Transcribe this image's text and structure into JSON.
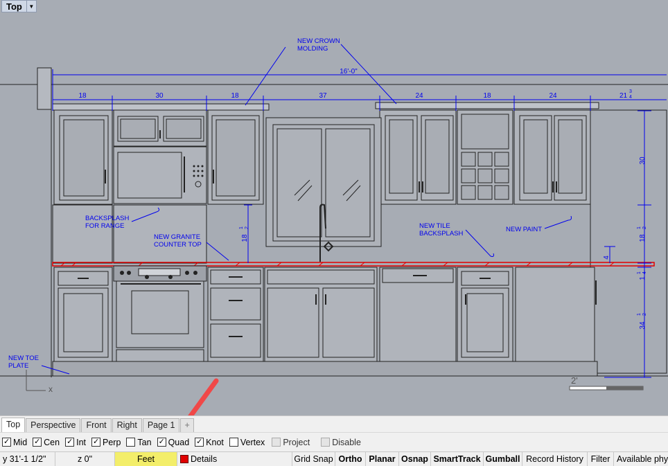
{
  "viewport": {
    "title": "Top",
    "dims": {
      "overall": "16'-0\"",
      "uppers": [
        "18",
        "30",
        "18",
        "37",
        "24",
        "18",
        "24"
      ],
      "right_top": "21",
      "right_top_frac_num": "3",
      "right_top_frac_den": "4",
      "right_upper_h": "30",
      "right_backsplash_whole": "18",
      "right_backsplash_num": "1",
      "right_backsplash_den": "2",
      "center_backsplash_whole": "18",
      "center_backsplash_num": "1",
      "center_backsplash_den": "2",
      "right_4": "4",
      "right_counter_whole": "1",
      "right_counter_num": "1",
      "right_counter_den": "4",
      "right_base_whole": "34",
      "right_base_num": "1",
      "right_base_den": "2"
    },
    "notes": {
      "crown_line1": "NEW CROWN",
      "crown_line2": "MOLDING",
      "backsplash_range_line1": "BACKSPLASH",
      "backsplash_range_line2": "FOR RANGE",
      "granite_line1": "NEW GRANITE",
      "granite_line2": "COUNTER TOP",
      "tile_line1": "NEW TILE",
      "tile_line2": "BACKSPLASH",
      "paint": "NEW PAINT",
      "toe_line1": "NEW TOE",
      "toe_line2": "PLATE"
    },
    "scale_label": "2'",
    "axis_x_label": "x"
  },
  "view_tabs": [
    "Top",
    "Perspective",
    "Front",
    "Right",
    "Page 1",
    "+"
  ],
  "osnaps": [
    {
      "label": "Mid",
      "checked": true,
      "enabled": true
    },
    {
      "label": "Cen",
      "checked": true,
      "enabled": true
    },
    {
      "label": "Int",
      "checked": true,
      "enabled": true
    },
    {
      "label": "Perp",
      "checked": true,
      "enabled": true
    },
    {
      "label": "Tan",
      "checked": false,
      "enabled": true
    },
    {
      "label": "Quad",
      "checked": true,
      "enabled": true
    },
    {
      "label": "Knot",
      "checked": true,
      "enabled": true
    },
    {
      "label": "Vertex",
      "checked": false,
      "enabled": true
    },
    {
      "label": "Project",
      "checked": false,
      "enabled": false
    },
    {
      "label": "Disable",
      "checked": false,
      "enabled": false
    }
  ],
  "status": {
    "y_coord": "y 31'-1 1/2\"",
    "z_coord": "z 0\"",
    "units": "Feet",
    "layer": "Details",
    "layer_color": "#e00000",
    "toggles": [
      "Grid Snap",
      "Ortho",
      "Planar",
      "Osnap",
      "SmartTrack",
      "Gumball",
      "Record History",
      "Filter"
    ],
    "toggles_bold": [
      false,
      true,
      true,
      true,
      true,
      true,
      false,
      false
    ],
    "memory": "Available phy"
  },
  "colors": {
    "viewport_bg": "#a7acb4",
    "dimension_blue": "#0000ee",
    "counter_red": "#e00000",
    "units_highlight": "#f3ee6a",
    "callout_arrow": "#f04848"
  }
}
